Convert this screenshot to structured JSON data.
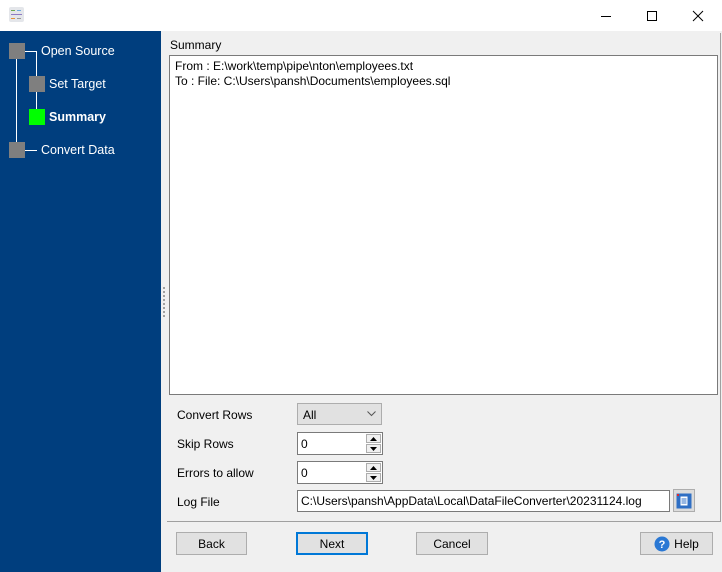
{
  "window": {
    "icon": "app-icon",
    "controls": [
      "minimize-icon",
      "maximize-icon",
      "close-icon"
    ]
  },
  "wizard": {
    "steps": [
      {
        "label": "Open Source",
        "state": "done"
      },
      {
        "label": "Set Target",
        "state": "done"
      },
      {
        "label": "Summary",
        "state": "current"
      },
      {
        "label": "Convert Data",
        "state": "pending"
      }
    ],
    "colors": {
      "sidebar": "#003e7e",
      "step_inactive": "#7f7f7f",
      "step_active": "#00ff00"
    }
  },
  "summary": {
    "title": "Summary",
    "lines": [
      "From : E:\\work\\temp\\pipe\\nton\\employees.txt",
      "To : File: C:\\Users\\pansh\\Documents\\employees.sql"
    ]
  },
  "options": {
    "convert_rows": {
      "label": "Convert Rows",
      "value": "All"
    },
    "skip_rows": {
      "label": "Skip Rows",
      "value": "0"
    },
    "errors_to_allow": {
      "label": "Errors to allow",
      "value": "0"
    },
    "log_file": {
      "label": "Log File",
      "value": "C:\\Users\\pansh\\AppData\\Local\\DataFileConverter\\20231124.log"
    }
  },
  "buttons": {
    "back": "Back",
    "next": "Next",
    "cancel": "Cancel",
    "help": "Help"
  }
}
